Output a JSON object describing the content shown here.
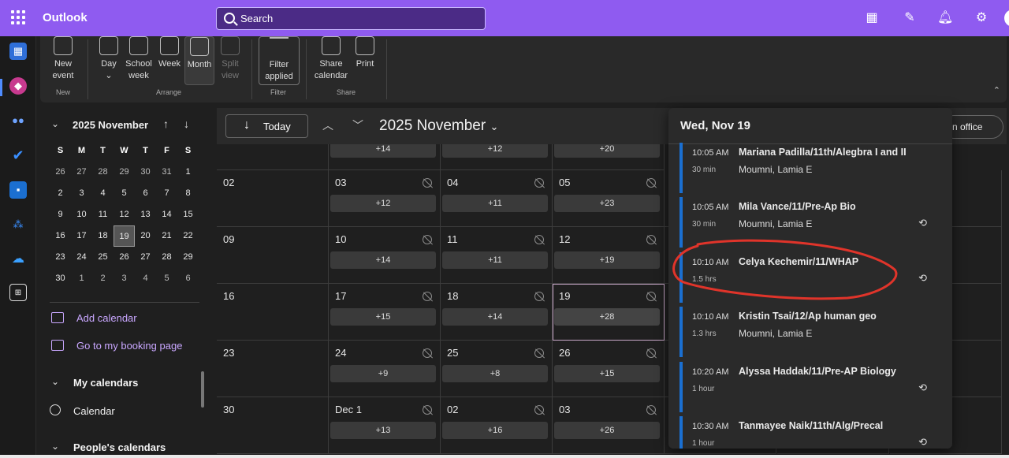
{
  "app": {
    "name": "Outlook"
  },
  "search": {
    "placeholder": "Search"
  },
  "ribbon": {
    "new_event": "New event",
    "day": "Day",
    "school_week": "School week",
    "week": "Week",
    "month": "Month",
    "split_view": "Split view",
    "filter": "Filter applied",
    "share_calendar": "Share calendar",
    "print": "Print",
    "groups": {
      "new": "New",
      "arrange": "Arrange",
      "filter": "Filter",
      "share": "Share"
    }
  },
  "mini_calendar": {
    "title": "2025 November",
    "dows": [
      "S",
      "M",
      "T",
      "W",
      "T",
      "F",
      "S"
    ],
    "weeks": [
      [
        "26",
        "27",
        "28",
        "29",
        "30",
        "31",
        "1"
      ],
      [
        "2",
        "3",
        "4",
        "5",
        "6",
        "7",
        "8"
      ],
      [
        "9",
        "10",
        "11",
        "12",
        "13",
        "14",
        "15"
      ],
      [
        "16",
        "17",
        "18",
        "19",
        "20",
        "21",
        "22"
      ],
      [
        "23",
        "24",
        "25",
        "26",
        "27",
        "28",
        "29"
      ],
      [
        "30",
        "1",
        "2",
        "3",
        "4",
        "5",
        "6"
      ]
    ],
    "today": "19"
  },
  "sidebar": {
    "add_calendar": "Add calendar",
    "booking": "Go to my booking page",
    "my_calendars": "My calendars",
    "calendar": "Calendar",
    "peoples_calendars": "People's calendars"
  },
  "toolbar": {
    "today": "Today",
    "month_title": "2025 November",
    "in_office": "n office"
  },
  "grid": {
    "top_row_more": [
      "+14",
      "+12",
      "+20"
    ],
    "rows": [
      [
        {
          "d": "02",
          "m": null
        },
        {
          "d": "03",
          "m": "+12"
        },
        {
          "d": "04",
          "m": "+11"
        },
        {
          "d": "05",
          "m": "+23"
        }
      ],
      [
        {
          "d": "09",
          "m": null
        },
        {
          "d": "10",
          "m": "+14"
        },
        {
          "d": "11",
          "m": "+11"
        },
        {
          "d": "12",
          "m": "+19"
        }
      ],
      [
        {
          "d": "16",
          "m": null
        },
        {
          "d": "17",
          "m": "+15"
        },
        {
          "d": "18",
          "m": "+14"
        },
        {
          "d": "19",
          "m": "+28"
        }
      ],
      [
        {
          "d": "23",
          "m": null
        },
        {
          "d": "24",
          "m": "+9"
        },
        {
          "d": "25",
          "m": "+8"
        },
        {
          "d": "26",
          "m": "+15"
        }
      ],
      [
        {
          "d": "30",
          "m": null
        },
        {
          "d": "Dec 1",
          "m": "+13"
        },
        {
          "d": "02",
          "m": "+16"
        },
        {
          "d": "03",
          "m": "+26"
        }
      ]
    ]
  },
  "popup": {
    "title": "Wed, Nov 19",
    "events": [
      {
        "time": "10:05 AM",
        "dur": "30 min",
        "subject": "Mariana Padilla/11th/Alegbra I and II",
        "organizer": "Moumni, Lamia E",
        "recurring": false
      },
      {
        "time": "10:05 AM",
        "dur": "30 min",
        "subject": "Mila Vance/11/Pre-Ap Bio",
        "organizer": "Moumni, Lamia E",
        "recurring": true
      },
      {
        "time": "10:10 AM",
        "dur": "1.5 hrs",
        "subject": "Celya Kechemir/11/WHAP",
        "organizer": "",
        "recurring": true
      },
      {
        "time": "10:10 AM",
        "dur": "1.3 hrs",
        "subject": "Kristin Tsai/12/Ap human geo",
        "organizer": "Moumni, Lamia E",
        "recurring": false
      },
      {
        "time": "10:20 AM",
        "dur": "1 hour",
        "subject": "Alyssa Haddak/11/Pre-AP Biology",
        "organizer": "",
        "recurring": true
      },
      {
        "time": "10:30 AM",
        "dur": "1 hour",
        "subject": "Tanmayee Naik/11th/Alg/Precal",
        "organizer": "",
        "recurring": true
      }
    ]
  },
  "colors": {
    "brand": "#8f5bf0",
    "event_bar": "#1a6fd1",
    "annotation": "#e0342a"
  }
}
